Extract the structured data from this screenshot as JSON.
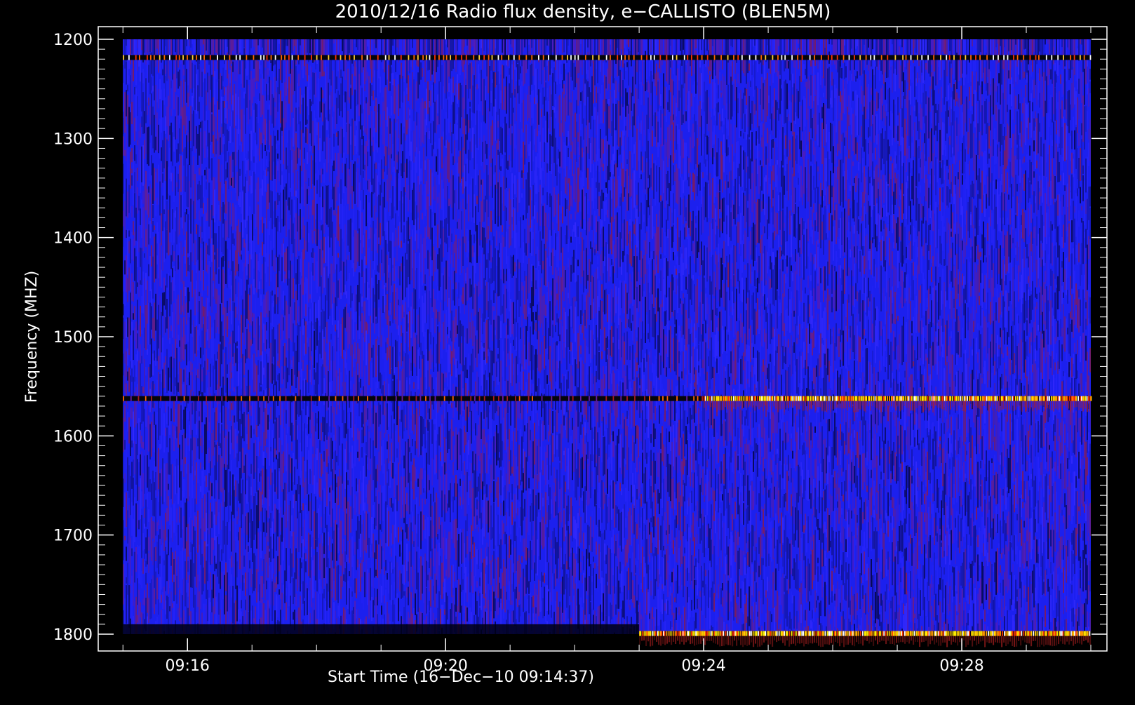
{
  "chart_data": {
    "type": "heatmap",
    "title": "2010/12/16  Radio flux density, e−CALLISTO (BLEN5M)",
    "xlabel": "Start Time (16−Dec−10 09:14:37)",
    "ylabel": "Frequency (MHZ)",
    "x_unit": "time (HH:MM)",
    "xlim": [
      "09:14:37",
      "09:30:15"
    ],
    "x_data_range": [
      "09:15:00",
      "09:30:00"
    ],
    "ylim": [
      1200,
      1800
    ],
    "y_inverted": true,
    "y_data_range": [
      1200,
      1800
    ],
    "x_ticks": [
      "09:16",
      "09:20",
      "09:24",
      "09:28"
    ],
    "y_ticks": [
      1200,
      1300,
      1400,
      1500,
      1600,
      1700,
      1800
    ],
    "colormap": [
      "#000000",
      "#1a14ff",
      "#b01a1a",
      "#ff3300",
      "#ffee00",
      "#ffffff"
    ],
    "background_color": "#1c20ee",
    "features": [
      {
        "description_label": "interference line",
        "frequency_mhz": 1218,
        "start": "09:15:00",
        "end": "09:30:00",
        "intensity": "medium"
      },
      {
        "description_label": "interference line",
        "frequency_mhz": 1562,
        "start": "09:15:00",
        "end": "09:24:00",
        "intensity": "low"
      },
      {
        "description_label": "interference line",
        "frequency_mhz": 1562,
        "start": "09:24:00",
        "end": "09:30:00",
        "intensity": "high"
      },
      {
        "description_label": "band edge",
        "frequency_mhz": 1799,
        "start": "09:23:00",
        "end": "09:30:00",
        "intensity": "high"
      }
    ]
  }
}
